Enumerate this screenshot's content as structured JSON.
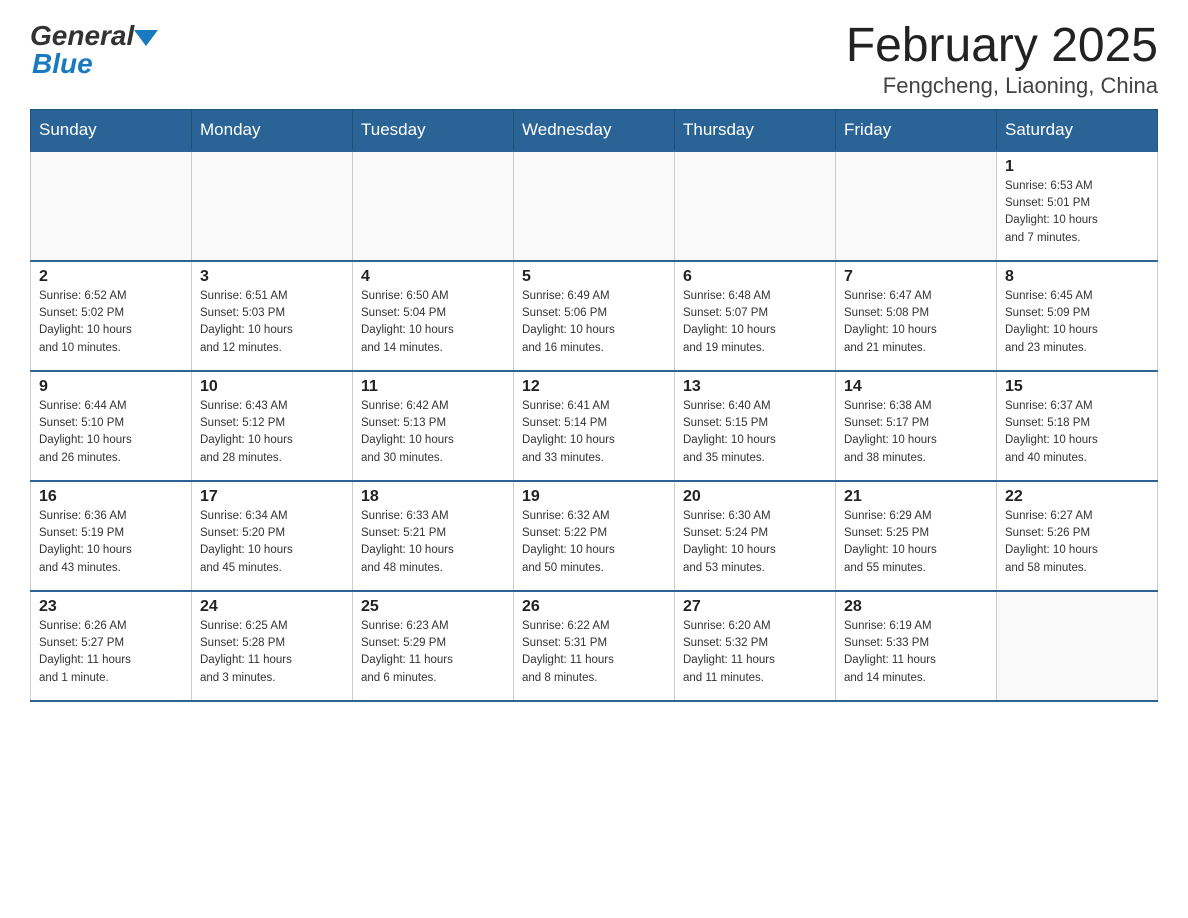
{
  "header": {
    "title": "February 2025",
    "subtitle": "Fengcheng, Liaoning, China",
    "logo_general": "General",
    "logo_blue": "Blue"
  },
  "weekdays": [
    "Sunday",
    "Monday",
    "Tuesday",
    "Wednesday",
    "Thursday",
    "Friday",
    "Saturday"
  ],
  "weeks": [
    [
      {
        "day": "",
        "info": ""
      },
      {
        "day": "",
        "info": ""
      },
      {
        "day": "",
        "info": ""
      },
      {
        "day": "",
        "info": ""
      },
      {
        "day": "",
        "info": ""
      },
      {
        "day": "",
        "info": ""
      },
      {
        "day": "1",
        "info": "Sunrise: 6:53 AM\nSunset: 5:01 PM\nDaylight: 10 hours\nand 7 minutes."
      }
    ],
    [
      {
        "day": "2",
        "info": "Sunrise: 6:52 AM\nSunset: 5:02 PM\nDaylight: 10 hours\nand 10 minutes."
      },
      {
        "day": "3",
        "info": "Sunrise: 6:51 AM\nSunset: 5:03 PM\nDaylight: 10 hours\nand 12 minutes."
      },
      {
        "day": "4",
        "info": "Sunrise: 6:50 AM\nSunset: 5:04 PM\nDaylight: 10 hours\nand 14 minutes."
      },
      {
        "day": "5",
        "info": "Sunrise: 6:49 AM\nSunset: 5:06 PM\nDaylight: 10 hours\nand 16 minutes."
      },
      {
        "day": "6",
        "info": "Sunrise: 6:48 AM\nSunset: 5:07 PM\nDaylight: 10 hours\nand 19 minutes."
      },
      {
        "day": "7",
        "info": "Sunrise: 6:47 AM\nSunset: 5:08 PM\nDaylight: 10 hours\nand 21 minutes."
      },
      {
        "day": "8",
        "info": "Sunrise: 6:45 AM\nSunset: 5:09 PM\nDaylight: 10 hours\nand 23 minutes."
      }
    ],
    [
      {
        "day": "9",
        "info": "Sunrise: 6:44 AM\nSunset: 5:10 PM\nDaylight: 10 hours\nand 26 minutes."
      },
      {
        "day": "10",
        "info": "Sunrise: 6:43 AM\nSunset: 5:12 PM\nDaylight: 10 hours\nand 28 minutes."
      },
      {
        "day": "11",
        "info": "Sunrise: 6:42 AM\nSunset: 5:13 PM\nDaylight: 10 hours\nand 30 minutes."
      },
      {
        "day": "12",
        "info": "Sunrise: 6:41 AM\nSunset: 5:14 PM\nDaylight: 10 hours\nand 33 minutes."
      },
      {
        "day": "13",
        "info": "Sunrise: 6:40 AM\nSunset: 5:15 PM\nDaylight: 10 hours\nand 35 minutes."
      },
      {
        "day": "14",
        "info": "Sunrise: 6:38 AM\nSunset: 5:17 PM\nDaylight: 10 hours\nand 38 minutes."
      },
      {
        "day": "15",
        "info": "Sunrise: 6:37 AM\nSunset: 5:18 PM\nDaylight: 10 hours\nand 40 minutes."
      }
    ],
    [
      {
        "day": "16",
        "info": "Sunrise: 6:36 AM\nSunset: 5:19 PM\nDaylight: 10 hours\nand 43 minutes."
      },
      {
        "day": "17",
        "info": "Sunrise: 6:34 AM\nSunset: 5:20 PM\nDaylight: 10 hours\nand 45 minutes."
      },
      {
        "day": "18",
        "info": "Sunrise: 6:33 AM\nSunset: 5:21 PM\nDaylight: 10 hours\nand 48 minutes."
      },
      {
        "day": "19",
        "info": "Sunrise: 6:32 AM\nSunset: 5:22 PM\nDaylight: 10 hours\nand 50 minutes."
      },
      {
        "day": "20",
        "info": "Sunrise: 6:30 AM\nSunset: 5:24 PM\nDaylight: 10 hours\nand 53 minutes."
      },
      {
        "day": "21",
        "info": "Sunrise: 6:29 AM\nSunset: 5:25 PM\nDaylight: 10 hours\nand 55 minutes."
      },
      {
        "day": "22",
        "info": "Sunrise: 6:27 AM\nSunset: 5:26 PM\nDaylight: 10 hours\nand 58 minutes."
      }
    ],
    [
      {
        "day": "23",
        "info": "Sunrise: 6:26 AM\nSunset: 5:27 PM\nDaylight: 11 hours\nand 1 minute."
      },
      {
        "day": "24",
        "info": "Sunrise: 6:25 AM\nSunset: 5:28 PM\nDaylight: 11 hours\nand 3 minutes."
      },
      {
        "day": "25",
        "info": "Sunrise: 6:23 AM\nSunset: 5:29 PM\nDaylight: 11 hours\nand 6 minutes."
      },
      {
        "day": "26",
        "info": "Sunrise: 6:22 AM\nSunset: 5:31 PM\nDaylight: 11 hours\nand 8 minutes."
      },
      {
        "day": "27",
        "info": "Sunrise: 6:20 AM\nSunset: 5:32 PM\nDaylight: 11 hours\nand 11 minutes."
      },
      {
        "day": "28",
        "info": "Sunrise: 6:19 AM\nSunset: 5:33 PM\nDaylight: 11 hours\nand 14 minutes."
      },
      {
        "day": "",
        "info": ""
      }
    ]
  ]
}
